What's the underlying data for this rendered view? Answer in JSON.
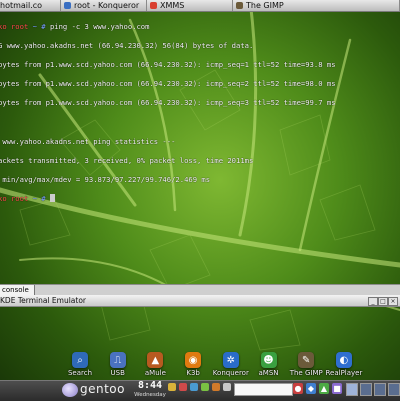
{
  "top_tabs": [
    {
      "label": "hotmail.co",
      "icon": "browser-icon",
      "color": "#c85a1e"
    },
    {
      "label": "root - Konqueror",
      "icon": "konqueror-icon",
      "color": "#3a6fc2"
    },
    {
      "label": "XMMS",
      "icon": "xmms-icon",
      "color": "#d94030"
    },
    {
      "label": "The GIMP",
      "icon": "gimp-icon",
      "color": "#6b5a3a"
    }
  ],
  "terminal": {
    "lines": [
      {
        "prompt_user": "ko root",
        "prompt_dir": " ~ # ",
        "text": "ping -c 3 www.yahoo.com"
      },
      {
        "text": "G www.yahoo.akadns.net (66.94.230.32) 56(84) bytes of data."
      },
      {
        "text": "bytes from p1.www.scd.yahoo.com (66.94.230.32): icmp_seq=1 ttl=52 time=93.8 ms"
      },
      {
        "text": "bytes from p1.www.scd.yahoo.com (66.94.230.32): icmp_seq=2 ttl=52 time=98.0 ms"
      },
      {
        "text": "bytes from p1.www.scd.yahoo.com (66.94.230.32): icmp_seq=3 ttl=52 time=99.7 ms"
      },
      {
        "text": ""
      },
      {
        "text": " www.yahoo.akadns.net ping statistics ---"
      },
      {
        "text": "ackets transmitted, 3 received, 0% packet loss, time 2011ms"
      },
      {
        "text": " min/avg/max/mdev = 93.873/97.227/99.746/2.469 ms"
      },
      {
        "prompt_user": "ko root",
        "prompt_dir": " ~ # ",
        "text": "",
        "cursor": true
      }
    ]
  },
  "console_tab": "console 1",
  "kde_window": {
    "title": "KDE Terminal Emulator"
  },
  "dock": [
    {
      "label": "Search",
      "icon": "search-icon",
      "color": "#2f6ab8",
      "glyph": "⌕"
    },
    {
      "label": "USB",
      "icon": "usb-icon",
      "color": "#4a72c0",
      "glyph": "⎍"
    },
    {
      "label": "aMule",
      "icon": "amule-icon",
      "color": "#b85a20",
      "glyph": "▲"
    },
    {
      "label": "K3b",
      "icon": "k3b-icon",
      "color": "#e07a10",
      "glyph": "◉"
    },
    {
      "label": "Konqueror",
      "icon": "konqueror-icon",
      "color": "#2a6cc8",
      "glyph": "✲"
    },
    {
      "label": "aMSN",
      "icon": "amsn-icon",
      "color": "#3aa040",
      "glyph": "☻"
    },
    {
      "label": "The GIMP",
      "icon": "gimp-icon",
      "color": "#6b5a3a",
      "glyph": "✎"
    },
    {
      "label": "RealPlayer",
      "icon": "realplayer-icon",
      "color": "#2f6fd0",
      "glyph": "◐"
    }
  ],
  "panel": {
    "brand": "gentoo",
    "clock_time": "8:44",
    "clock_day": "Wednesday",
    "tray_colors": [
      "#d8b23a",
      "#d14a4a",
      "#4a9ad1",
      "#7ac143",
      "#d17a2a",
      "#c8c8c8"
    ]
  }
}
